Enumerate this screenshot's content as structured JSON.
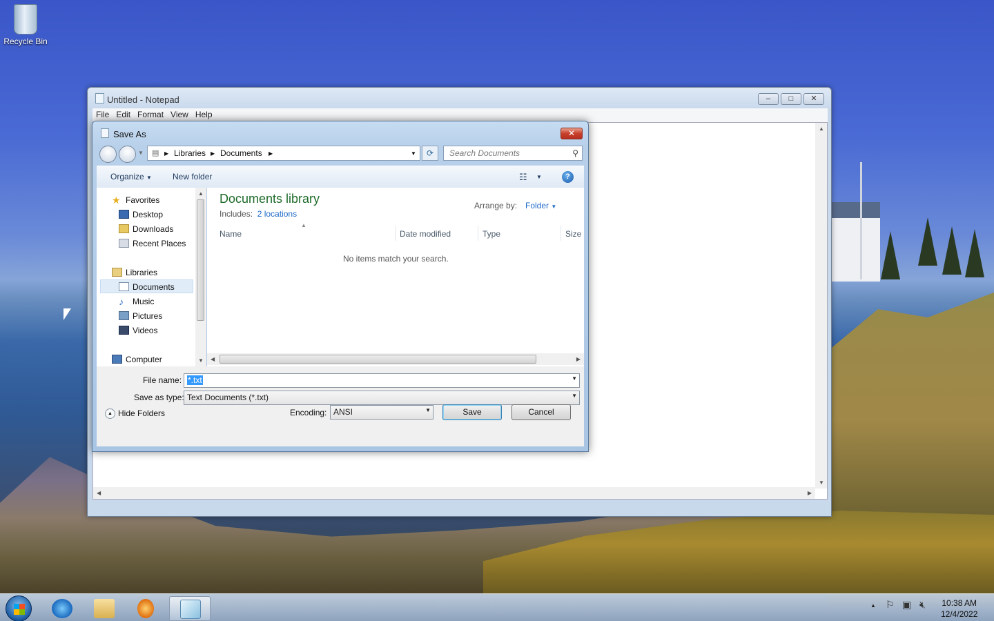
{
  "desktop": {
    "recycle_bin": "Recycle Bin"
  },
  "notepad": {
    "title": "Untitled - Notepad",
    "menu": [
      "File",
      "Edit",
      "Format",
      "View",
      "Help"
    ]
  },
  "dialog": {
    "title": "Save As",
    "address": [
      "Libraries",
      "Documents"
    ],
    "search_placeholder": "Search Documents",
    "toolbar": {
      "organize": "Organize",
      "new_folder": "New folder"
    },
    "nav": {
      "favorites": "Favorites",
      "desktop": "Desktop",
      "downloads": "Downloads",
      "recent": "Recent Places",
      "libraries": "Libraries",
      "documents": "Documents",
      "music": "Music",
      "pictures": "Pictures",
      "videos": "Videos",
      "computer": "Computer"
    },
    "library": {
      "title": "Documents library",
      "includes_label": "Includes:",
      "includes_link": "2 locations",
      "arrange_label": "Arrange by:",
      "arrange_value": "Folder"
    },
    "columns": [
      "Name",
      "Date modified",
      "Type",
      "Size"
    ],
    "empty_message": "No items match your search.",
    "file_name_label": "File name:",
    "file_name_value": "*.txt",
    "save_type_label": "Save as type:",
    "save_type_value": "Text Documents (*.txt)",
    "encoding_label": "Encoding:",
    "encoding_value": "ANSI",
    "save_button": "Save",
    "cancel_button": "Cancel",
    "hide_folders": "Hide Folders"
  },
  "taskbar": {
    "time": "10:38 AM",
    "date": "12/4/2022"
  },
  "colors": {
    "accent": "#1e6a2a",
    "link": "#1e6ac8",
    "selection": "#3399ff"
  }
}
